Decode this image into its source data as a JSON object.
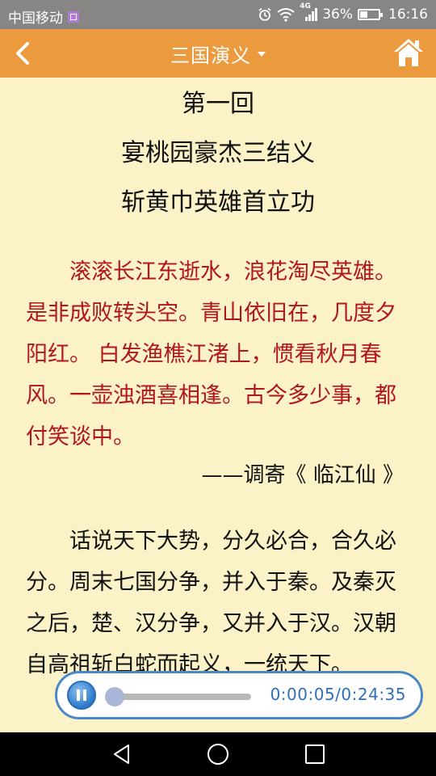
{
  "status_bar": {
    "carrier": "中国移动",
    "network": "4G",
    "battery_text": "36%",
    "battery_level": 0.36,
    "time": "16:16"
  },
  "header": {
    "title": "三国演义",
    "accent_color": "#EB9B3E"
  },
  "chapter": {
    "number": "第一回",
    "title_line1": "宴桃园豪杰三结义",
    "title_line2": "斩黄巾英雄首立功"
  },
  "poem": {
    "text": "滚滚长江东逝水，浪花淘尽英雄。是非成败转头空。青山依旧在，几度夕阳红。 白发渔樵江渚上，惯看秋月春风。一壶浊酒喜相逢。古今多少事，都付笑谈中。",
    "color": "#B0161B",
    "source": "——调寄《 临江仙 》"
  },
  "body": {
    "text": "话说天下大势，分久必合，合久必分。周末七国分争，并入于秦。及秦灭之后，楚、汉分争，又并入于汉。汉朝自高祖斩白蛇而起义，一统天下。"
  },
  "player": {
    "time": "0:00:05/0:24:35",
    "progress": 0.003
  },
  "icons": {
    "back": "chevron-left-icon",
    "home": "home-icon",
    "dropdown": "caret-down-icon",
    "pause": "pause-icon",
    "nav_back": "triangle-back-icon",
    "nav_home": "circle-home-icon",
    "nav_recents": "square-recents-icon"
  }
}
